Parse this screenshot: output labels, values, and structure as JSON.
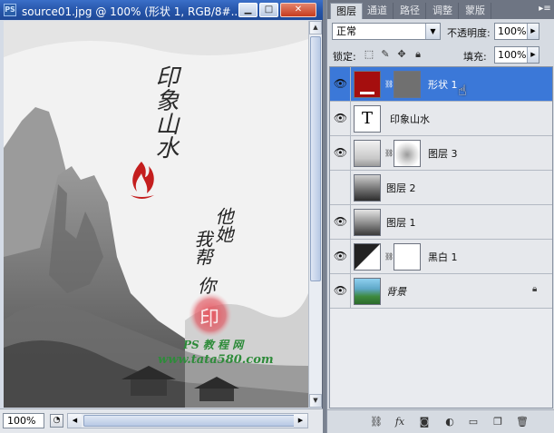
{
  "document": {
    "title": "source01.jpg @ 100% (形状 1, RGB/8#...",
    "app_icon": "PS",
    "window_buttons": {
      "minimize": "▁",
      "maximize": "□",
      "close": "✕"
    },
    "zoom": "100%",
    "artwork": {
      "title_calligraphy": "印象山水",
      "poem_line_1": "他她",
      "poem_line_2": "我帮",
      "poem_line_3": "你",
      "seal_text": "印",
      "watermark_1": "PS 教 程 网",
      "watermark_2": "www.tata580.com",
      "seal_color": "#d9363e",
      "flame_color": "#c41e1e"
    }
  },
  "panel": {
    "tabs": [
      {
        "label": "图层",
        "active": true
      },
      {
        "label": "通道",
        "active": false
      },
      {
        "label": "路径",
        "active": false
      },
      {
        "label": "调整",
        "active": false
      },
      {
        "label": "蒙版",
        "active": false
      }
    ],
    "menu_icon": "▸≡",
    "blend_mode": "正常",
    "opacity_label": "不透明度:",
    "opacity_value": "100%",
    "lock_label": "锁定:",
    "fill_label": "填充:",
    "fill_value": "100%",
    "lock_icons": [
      "lock-transparency-icon",
      "lock-image-icon",
      "lock-position-icon",
      "lock-all-icon"
    ],
    "layers": [
      {
        "name": "形状 1",
        "visible": true,
        "selected": true,
        "type": "shape"
      },
      {
        "name": "印象山水",
        "visible": true,
        "selected": false,
        "type": "text",
        "thumb_text": "T"
      },
      {
        "name": "图层 3",
        "visible": true,
        "selected": false,
        "type": "masked"
      },
      {
        "name": "图层 2",
        "visible": false,
        "selected": false,
        "type": "image"
      },
      {
        "name": "图层 1",
        "visible": true,
        "selected": false,
        "type": "image"
      },
      {
        "name": "黑白 1",
        "visible": true,
        "selected": false,
        "type": "adjustment"
      },
      {
        "name": "背景",
        "visible": true,
        "selected": false,
        "type": "background",
        "locked": true
      }
    ],
    "bottom_icons": [
      "link-layers-icon",
      "fx-icon",
      "add-mask-icon",
      "adjustment-layer-icon",
      "new-group-icon",
      "new-layer-icon",
      "delete-icon"
    ],
    "accent_color": "#3b78d8"
  }
}
